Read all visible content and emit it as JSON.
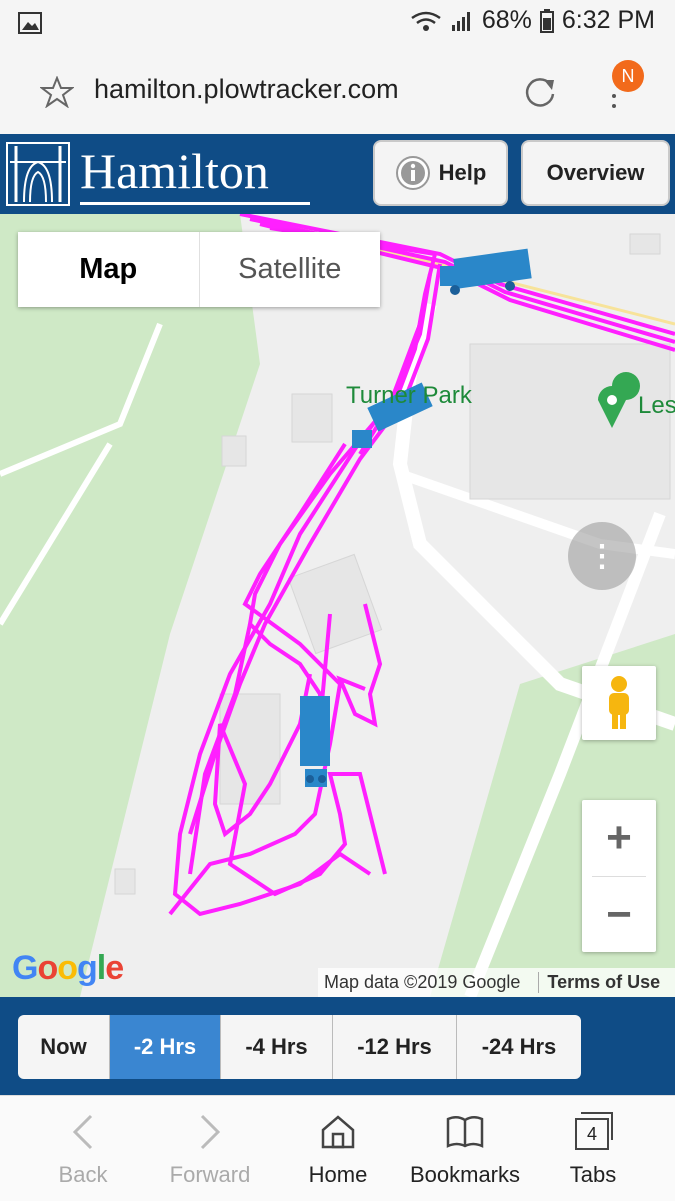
{
  "status": {
    "battery": "68%",
    "time": "6:32 PM"
  },
  "browser": {
    "url": "hamilton.plowtracker.com",
    "profile_initial": "N"
  },
  "header": {
    "logo_text": "Hamilton",
    "help_label": "Help",
    "overview_label": "Overview"
  },
  "map": {
    "map_type_options": [
      "Map",
      "Satellite"
    ],
    "selected_map_type": "Map",
    "place_label": "Turner Park",
    "pin_label": "Les",
    "attribution": "Map data ©2019 Google",
    "terms_label": "Terms of Use",
    "google_logo": "Google",
    "zoom_in": "+",
    "zoom_out": "−",
    "more_dots": "⋮"
  },
  "time_filters": [
    "Now",
    "-2 Hrs",
    "-4 Hrs",
    "-12 Hrs",
    "-24 Hrs"
  ],
  "selected_time_filter": "-2 Hrs",
  "bottom_nav": [
    {
      "label": "Back",
      "icon": "back-icon"
    },
    {
      "label": "Forward",
      "icon": "forward-icon"
    },
    {
      "label": "Home",
      "icon": "home-icon"
    },
    {
      "label": "Bookmarks",
      "icon": "bookmarks-icon"
    },
    {
      "label": "Tabs",
      "icon": "tabs-icon",
      "count": "4"
    }
  ],
  "colors": {
    "header": "#0f4c86",
    "track": "#ff20ff",
    "active_filter": "#3a86d1"
  }
}
